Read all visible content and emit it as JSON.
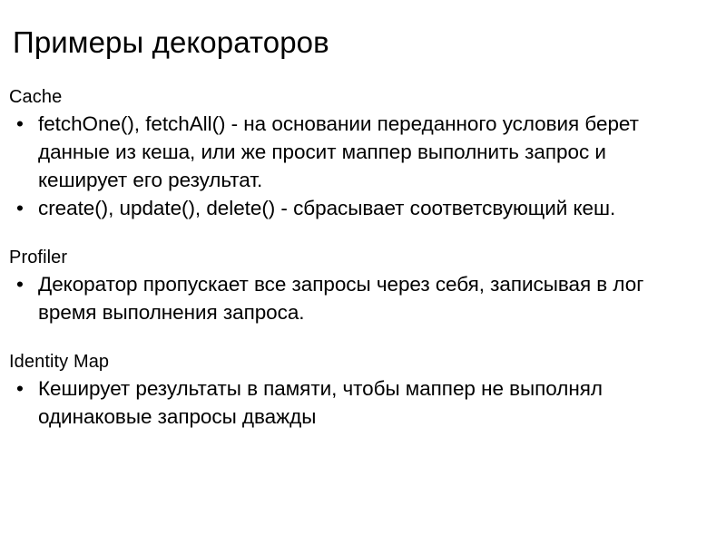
{
  "slide": {
    "title": "Примеры декораторов",
    "bullet_glyph": "•",
    "text_color": "#000000",
    "background_color": "#ffffff",
    "sections": [
      {
        "heading": "Cache",
        "bullets": [
          "fetchOne(), fetchAll() - на основании переданного условия берет данные из кеша, или же просит маппер выполнить запрос и кеширует его результат.",
          "create(), update(), delete() - сбрасывает соответсвующий кеш."
        ]
      },
      {
        "heading": "Profiler",
        "bullets": [
          "Декоратор пропускает все запросы через себя, записывая в лог время выполнения запроса."
        ]
      },
      {
        "heading": "Identity Map",
        "bullets": [
          "Кеширует результаты в памяти, чтобы маппер не выполнял одинаковые запросы дважды"
        ]
      }
    ]
  }
}
